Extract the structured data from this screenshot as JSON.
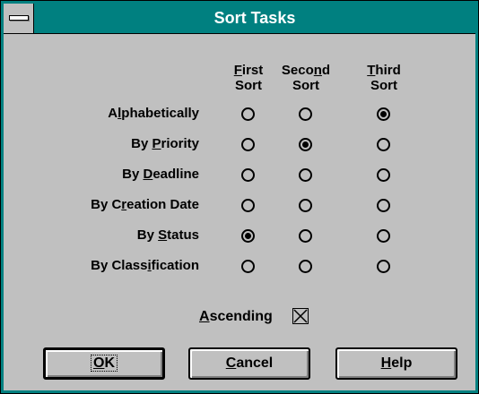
{
  "window": {
    "title": "Sort Tasks",
    "border_color": "#008080",
    "face_color": "#c0c0c0"
  },
  "columns": [
    {
      "line1": "First",
      "line1_mnemonic_index": 0,
      "line2": "Sort"
    },
    {
      "line1": "Second",
      "line1_mnemonic_index": 4,
      "line2": "Sort"
    },
    {
      "line1": "Third",
      "line1_mnemonic_index": 0,
      "line2": "Sort"
    }
  ],
  "rows": [
    {
      "label": "Alphabetically",
      "mnemonic": "l",
      "mnemonic_index": 1,
      "selected_column": 3
    },
    {
      "label": "By Priority",
      "mnemonic": "P",
      "mnemonic_index": 3,
      "selected_column": 2
    },
    {
      "label": "By Deadline",
      "mnemonic": "D",
      "mnemonic_index": 3,
      "selected_column": 0
    },
    {
      "label": "By Creation Date",
      "mnemonic": "r",
      "mnemonic_index": 4,
      "selected_column": 0
    },
    {
      "label": "By Status",
      "mnemonic": "S",
      "mnemonic_index": 3,
      "selected_column": 1
    },
    {
      "label": "By Classification",
      "mnemonic": "i",
      "mnemonic_index": 8,
      "selected_column": 0
    }
  ],
  "ascending": {
    "label": "Ascending",
    "mnemonic_index": 0,
    "checked": true
  },
  "buttons": [
    {
      "id": "ok",
      "label": "OK",
      "mnemonic_index": 0,
      "default": true
    },
    {
      "id": "cancel",
      "label": "Cancel",
      "mnemonic_index": 0,
      "default": false
    },
    {
      "id": "help",
      "label": "Help",
      "mnemonic_index": 0,
      "default": false
    }
  ]
}
